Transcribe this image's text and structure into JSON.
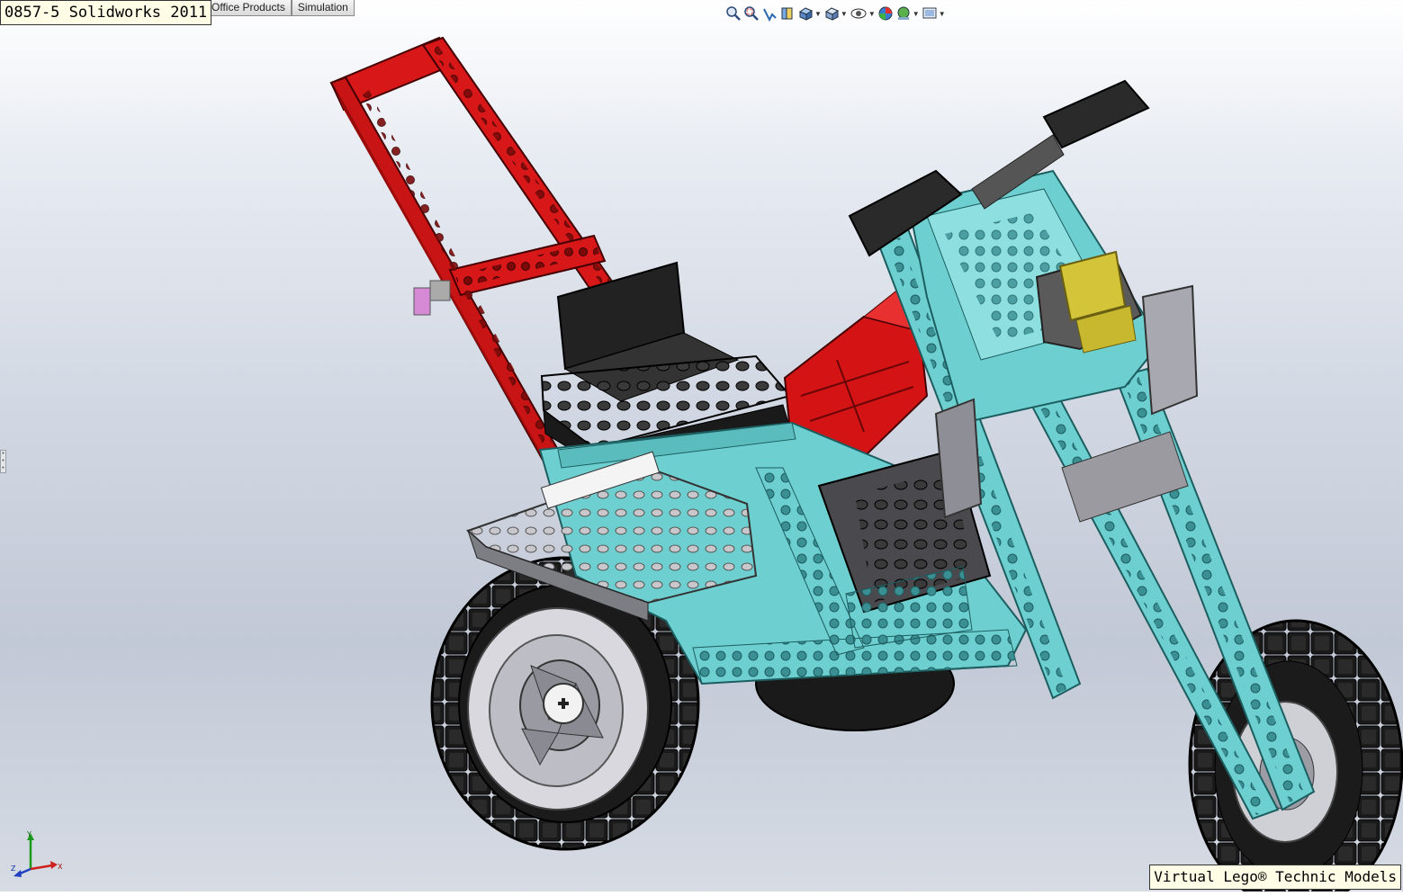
{
  "title_box": "0857-5 Solidworks 2011",
  "command_tabs": [
    {
      "label": "Office Products"
    },
    {
      "label": "Simulation"
    }
  ],
  "view_toolbar": {
    "icons": [
      "zoom-to-fit-icon",
      "zoom-to-area-icon",
      "previous-view-icon",
      "section-view-icon",
      "view-orientation-icon",
      "display-style-icon",
      "hide-show-items-icon",
      "edit-appearance-icon",
      "apply-scene-icon",
      "view-settings-icon"
    ]
  },
  "model": {
    "colors": {
      "frame": "#6ecfd0",
      "frame_dark": "#3e9fa3",
      "handlebar": "#d81818",
      "seat": "#1e1e1e",
      "tank": "#d41414",
      "gray_plates": "#9a9aa0",
      "tire": "#161616",
      "hub": "#b8b8c0",
      "light": "#d4c43a"
    }
  },
  "triad": {
    "x_label": "X",
    "y_label": "Y",
    "z_label": "Z"
  },
  "footer": {
    "text": "Virtual Lego",
    "registered": "®",
    "suffix": " Technic Models"
  }
}
